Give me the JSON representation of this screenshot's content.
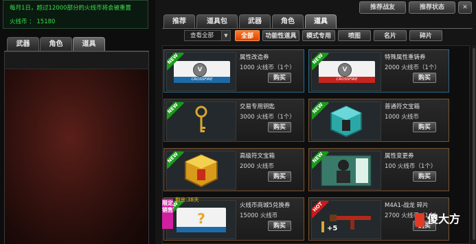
{
  "notice": {
    "line1": "每月1日，超过12000部分的火线币将会被重置",
    "line2": "火线币 ： 15180"
  },
  "left_tabs": [
    "武器",
    "角色",
    "道具"
  ],
  "left_active_tab": "道具",
  "top_buttons": [
    "推荐战友",
    "推荐状态"
  ],
  "category_tabs": [
    "推荐",
    "道具包",
    "武器",
    "角色",
    "道具"
  ],
  "active_category": "道具",
  "filter": {
    "select_value": "查看全部",
    "buttons": [
      "全部",
      "功能性道具",
      "模式专用",
      "喷图",
      "名片",
      "碎片"
    ],
    "active": "全部"
  },
  "items": [
    {
      "name": "属性改造券",
      "price": "1000 火线币（1个）",
      "buy": "购买",
      "badge": "NEW",
      "icon": "ticket-blue-icon"
    },
    {
      "name": "特殊属性重铸券",
      "price": "2000 火线币（1个）",
      "buy": "购买",
      "badge": "NEW",
      "icon": "ticket-red-icon"
    },
    {
      "name": "交易专用钥匙",
      "price": "3000 火线币（1个）",
      "buy": "购买",
      "badge": "NEW",
      "icon": "key-icon"
    },
    {
      "name": "普通符文宝箱",
      "price": "1000 火线币",
      "buy": "购买",
      "badge": "NEW",
      "icon": "teal-box-icon"
    },
    {
      "name": "高级符文宝箱",
      "price": "2000 火线币",
      "buy": "购买",
      "badge": "NEW",
      "icon": "gold-box-icon"
    },
    {
      "name": "属性变更券",
      "price": "100 火线币（1个）",
      "buy": "购买",
      "badge": "NEW",
      "icon": "soldier-card-icon"
    },
    {
      "name": "火线币商城5兑换券",
      "price": "15000 火线币",
      "buy": "购买",
      "badge": "NEW",
      "icon": "mystery-ticket-icon"
    },
    {
      "name": "M4A1-战龙 碎片",
      "price": "2700 火线币（1个）",
      "buy": "购买",
      "badge": "HOT",
      "icon": "rifle-fragment-icon"
    }
  ],
  "limited_badge": "限定\n销售",
  "item7_tag": "剩余:38天",
  "item8_plus": "+5",
  "watermark": "傻大方",
  "colors": {
    "accent": "#ff6a1a",
    "notice_text": "#39e04a",
    "new_badge": "#1a9a1a",
    "hot_badge": "#c81a1a"
  }
}
